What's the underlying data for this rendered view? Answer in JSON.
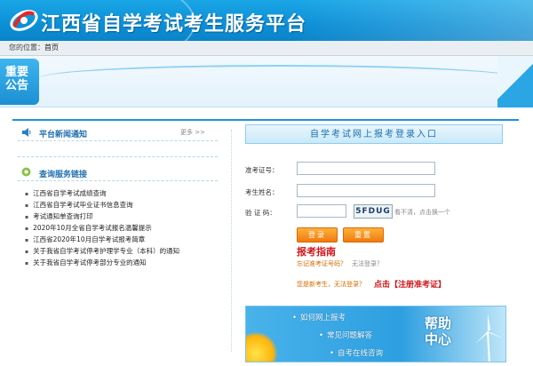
{
  "header": {
    "title": "江西省自学考试考生服务平台",
    "icon": "logo-swirl-icon"
  },
  "breadcrumb": {
    "label": "您的位置：",
    "current": "首页"
  },
  "notice": {
    "badge": "重要公告"
  },
  "news": {
    "title": "平台新闻通知",
    "more": "更多 >>",
    "icon": "speaker-icon"
  },
  "services": {
    "title": "查询服务链接",
    "icon": "circle-bullet-icon",
    "links": [
      "江西省自学考试成绩查询",
      "江西省自学考试毕业证书信息查询",
      "考试通知单查询打印",
      "2020年10月全省自学考试报名温馨提示",
      "江西省2020年10月自学考试报考简章",
      "关于我省自学考试停考护理学专业（本科）的通知",
      "关于我省自学考试停考部分专业的通知"
    ]
  },
  "login": {
    "title": "自学考试网上报考登录入口",
    "id_label": "准考证号：",
    "name_label": "考生姓名：",
    "code_label": "验 证 码：",
    "captcha": "5FDUG",
    "captcha_tip": "看不清，点击换一个",
    "login_btn": "登录",
    "reset_btn": "重置",
    "guide": "报考指南",
    "forgot": "忘记准考证号码？",
    "cannot_login": "无法登录？",
    "newcomer": "您是新考生，无法登录？",
    "register": "点击【注册准考证】"
  },
  "help": {
    "items": [
      "如何网上报考",
      "常见问题解答",
      "自考在线咨询"
    ],
    "title": "帮助中心"
  }
}
